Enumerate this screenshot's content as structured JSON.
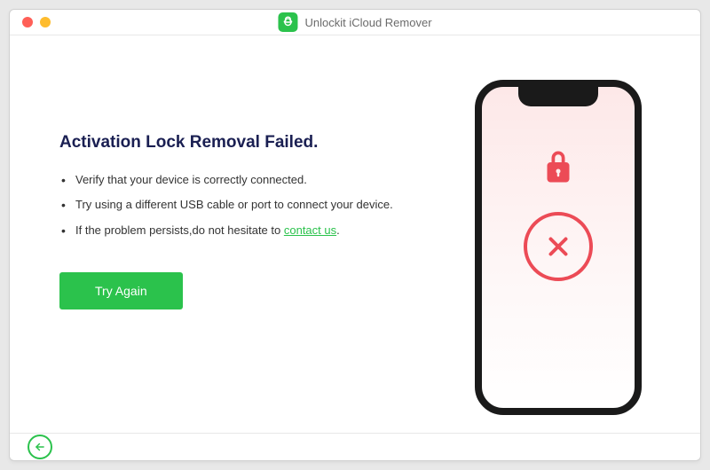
{
  "app": {
    "title": "Unlockit iCloud Remover"
  },
  "main": {
    "heading": "Activation Lock Removal Failed.",
    "bullets": [
      "Verify that your device is correctly connected.",
      "Try using a different USB cable or port to connect your device."
    ],
    "bullet3_prefix": "If the problem persists,do not hesitate to ",
    "bullet3_link": "contact us",
    "bullet3_suffix": ".",
    "try_again_label": "Try Again"
  },
  "colors": {
    "accent": "#2bc24c",
    "error": "#ec4b56"
  }
}
